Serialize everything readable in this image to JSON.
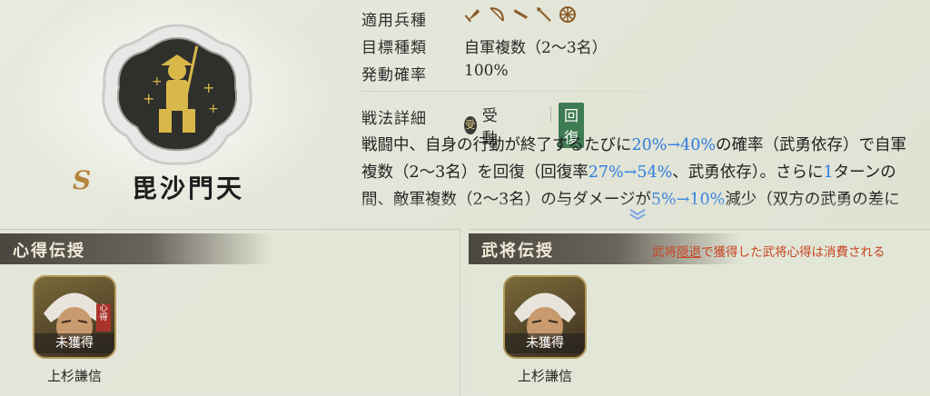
{
  "skill": {
    "rank": "S",
    "name": "毘沙門天",
    "details": {
      "unit_type_label": "適用兵種",
      "unit_types": [
        "axe-icon",
        "bow-icon",
        "gun-icon",
        "spear-icon",
        "cavalry-wheel-icon"
      ],
      "target_label": "目標種類",
      "target_value": "自軍複数（2〜3名）",
      "activation_label": "発動確率",
      "activation_value": "100%"
    },
    "tactics_label": "戦法詳細",
    "passive_icon_char": "受",
    "passive_label": "受動",
    "heal_tag": "回復",
    "description": {
      "p1": "戦闘中、自身の行動が終了するたびに",
      "h1": "20%→40%",
      "p2": "の確率（武勇依存）で自軍複数（2〜3名）を回復（回復率",
      "h2": "27%→54%",
      "p3": "、武勇依存）。さらに",
      "h3": "1",
      "p4": "ターンの間、敵軍複数（2〜3名）の与ダメージが",
      "h4": "5%→10%",
      "p5": "減少（双方の武勇の差に依存）"
    }
  },
  "left_panel": {
    "title": "心得伝授",
    "card": {
      "status": "未獲得",
      "name": "上杉謙信",
      "stamp": "心得"
    }
  },
  "right_panel": {
    "title": "武将伝授",
    "notice_pre": "武将",
    "notice_link": "隠退",
    "notice_post": "で獲得した武将心得は消費される",
    "card": {
      "status": "未獲得",
      "name": "上杉謙信"
    }
  },
  "colors": {
    "highlight": "#2f7de0",
    "heal_tag": "#3f7c53",
    "notice": "#c8431f",
    "rank": "#b5833a"
  }
}
